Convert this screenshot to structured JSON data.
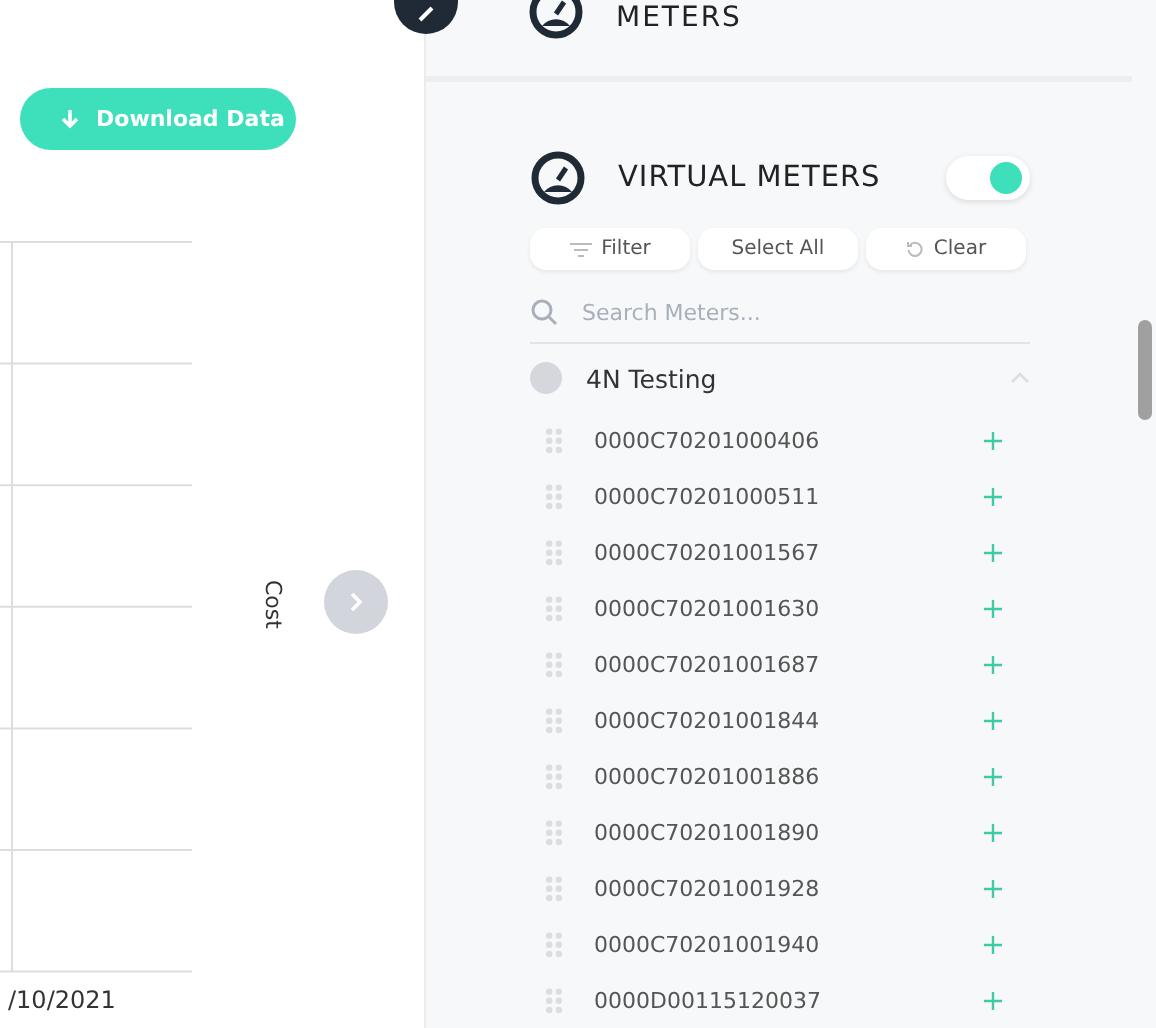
{
  "left_panel": {
    "download_button": {
      "label": "Download Data"
    },
    "chart": {
      "x_label": "/10/2021",
      "axis_title": "Cost"
    }
  },
  "sidebar": {
    "top_section": {
      "title": "METERS"
    },
    "virtual_meters": {
      "title": "VIRTUAL METERS",
      "toggle": {
        "on": true
      },
      "actions": [
        "Filter",
        "Select All",
        "Clear"
      ],
      "search": {
        "placeholder": "Search Meters..."
      },
      "groups": [
        {
          "name": "4N Testing",
          "expanded": true,
          "children": [
            {
              "name": "0000C70201000406"
            },
            {
              "name": "0000C70201000511"
            },
            {
              "name": "0000C70201001567"
            },
            {
              "name": "0000C70201001630"
            },
            {
              "name": "0000C70201001687"
            },
            {
              "name": "0000C70201001844"
            },
            {
              "name": "0000C70201001886"
            },
            {
              "name": "0000C70201001890"
            },
            {
              "name": "0000C70201001928"
            },
            {
              "name": "0000C70201001940"
            },
            {
              "name": "0000D00115120037"
            }
          ]
        }
      ]
    }
  }
}
